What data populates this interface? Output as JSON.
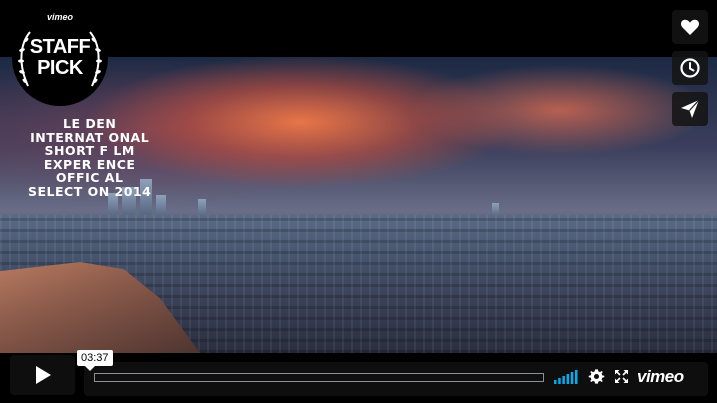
{
  "badge": {
    "brand": "vimeo",
    "line1": "STAFF",
    "line2": "PICK"
  },
  "festival": {
    "lines": [
      "LE DEN",
      "INTERNAT ONAL",
      "SHORT F LM",
      "EXPER ENCE",
      "OFFIC AL",
      "SELECT ON 2014"
    ]
  },
  "side_actions": {
    "like": "heart-icon",
    "watch_later": "clock-icon",
    "share": "paper-plane-icon"
  },
  "player": {
    "current_time": "03:37",
    "progress": 0.0,
    "brand": "vimeo"
  },
  "colors": {
    "accent": "#00adef",
    "control_bg": "#0f0f0f"
  }
}
